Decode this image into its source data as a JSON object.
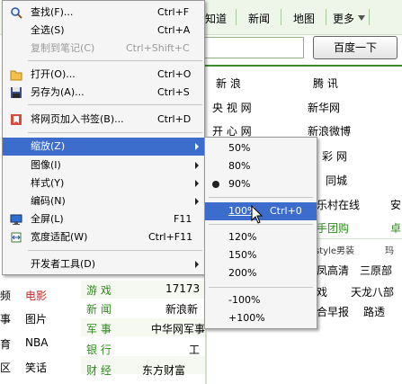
{
  "background": {
    "nav": {
      "item1": "知道",
      "item2": "新闻",
      "item3": "地图",
      "more": "更多"
    },
    "search_button": "百度一下",
    "sites": {
      "r1": [
        "新 浪",
        "腾 讯"
      ],
      "r2": [
        "央 视 网",
        "新华网"
      ],
      "r3": [
        "开 心 网",
        "新浪微博"
      ],
      "r4": [
        "彩 网"
      ],
      "r5": [
        "同城"
      ],
      "r6": [
        "乐村在线",
        "安"
      ],
      "r7": [
        "手团购",
        "卓"
      ],
      "r8": [
        "style男装",
        "玛"
      ],
      "r9": [
        "凤高清",
        "三原部"
      ],
      "r10": [
        "戏",
        "天龙八部"
      ],
      "r11": [
        "合早报",
        "路透"
      ]
    },
    "left_col": [
      "频",
      "事",
      "育",
      "区"
    ],
    "categories": [
      {
        "left": "电影",
        "label": "游 戏",
        "value": "17173"
      },
      {
        "left": "图片",
        "label": "新 闻",
        "value": "新浪新"
      },
      {
        "left": "NBA",
        "label": "军 事",
        "value": "中华网军事"
      },
      {
        "left": "笑话",
        "label": "银 行",
        "value": "工"
      },
      {
        "left": "",
        "label": "财 经",
        "value": "东方财富"
      }
    ]
  },
  "context_menu": {
    "items": [
      {
        "label": "查找(F)...",
        "shortcut": "Ctrl+F"
      },
      {
        "label": "全选(S)",
        "shortcut": "Ctrl+A"
      },
      {
        "label": "复制到笔记(C)",
        "shortcut": "Ctrl+Shift+C"
      },
      {
        "label": "打开(O)...",
        "shortcut": "Ctrl+O"
      },
      {
        "label": "另存为(A)...",
        "shortcut": "Ctrl+S"
      },
      {
        "label": "将网页加入书签(B)...",
        "shortcut": "Ctrl+D"
      },
      {
        "label": "缩放(Z)",
        "shortcut": ""
      },
      {
        "label": "图像(I)",
        "shortcut": ""
      },
      {
        "label": "样式(Y)",
        "shortcut": ""
      },
      {
        "label": "编码(N)",
        "shortcut": ""
      },
      {
        "label": "全屏(L)",
        "shortcut": "F11"
      },
      {
        "label": "宽度适配(W)",
        "shortcut": "Ctrl+F11"
      },
      {
        "label": "开发者工具(D)",
        "shortcut": ""
      }
    ]
  },
  "zoom_menu": {
    "items": [
      "50%",
      "80%",
      "90%",
      "100%",
      "120%",
      "150%",
      "200%",
      "-100%",
      "+100%"
    ],
    "hover_shortcut": "Ctrl+0",
    "checked": "90%"
  },
  "colors": {
    "highlight": "#3d6dcc",
    "menu_bg": "#f5f5f5",
    "page_green": "#eef6ea"
  }
}
